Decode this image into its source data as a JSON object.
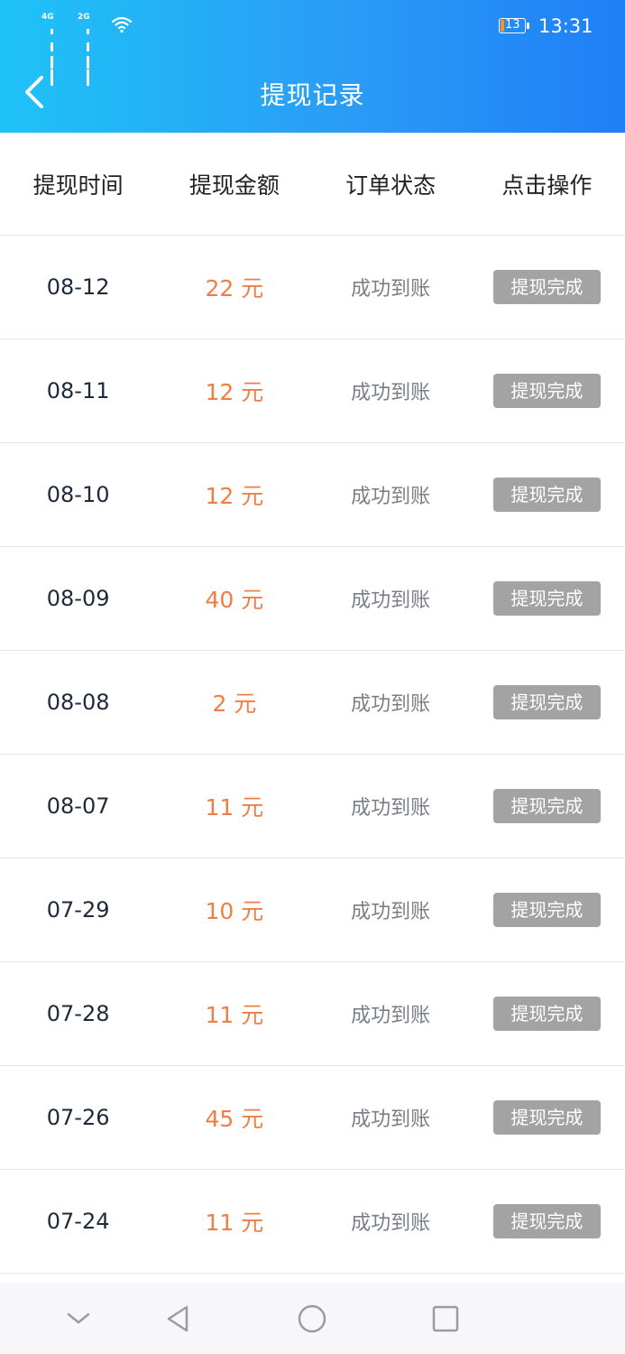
{
  "status_bar": {
    "signal1_label": "4G",
    "signal2_label": "2G",
    "battery_level": "13",
    "time": "13:31"
  },
  "header": {
    "title": "提现记录",
    "back_icon": "chevron-left-icon"
  },
  "table": {
    "columns": [
      "提现时间",
      "提现金额",
      "订单状态",
      "点击操作"
    ],
    "rows": [
      {
        "date": "08-12",
        "amount": "22 元",
        "status": "成功到账",
        "action": "提现完成"
      },
      {
        "date": "08-11",
        "amount": "12 元",
        "status": "成功到账",
        "action": "提现完成"
      },
      {
        "date": "08-10",
        "amount": "12 元",
        "status": "成功到账",
        "action": "提现完成"
      },
      {
        "date": "08-09",
        "amount": "40 元",
        "status": "成功到账",
        "action": "提现完成"
      },
      {
        "date": "08-08",
        "amount": "2 元",
        "status": "成功到账",
        "action": "提现完成"
      },
      {
        "date": "08-07",
        "amount": "11 元",
        "status": "成功到账",
        "action": "提现完成"
      },
      {
        "date": "07-29",
        "amount": "10 元",
        "status": "成功到账",
        "action": "提现完成"
      },
      {
        "date": "07-28",
        "amount": "11 元",
        "status": "成功到账",
        "action": "提现完成"
      },
      {
        "date": "07-26",
        "amount": "45 元",
        "status": "成功到账",
        "action": "提现完成"
      },
      {
        "date": "07-24",
        "amount": "11 元",
        "status": "成功到账",
        "action": "提现完成"
      }
    ]
  },
  "nav_bar": {
    "icons": [
      "chevron-down-icon",
      "back-triangle-icon",
      "home-circle-icon",
      "recents-square-icon"
    ]
  },
  "colors": {
    "header_start": "#1ec3f7",
    "header_end": "#1f7ff6",
    "amount": "#f07d43",
    "button_bg": "#a3a3a3"
  }
}
